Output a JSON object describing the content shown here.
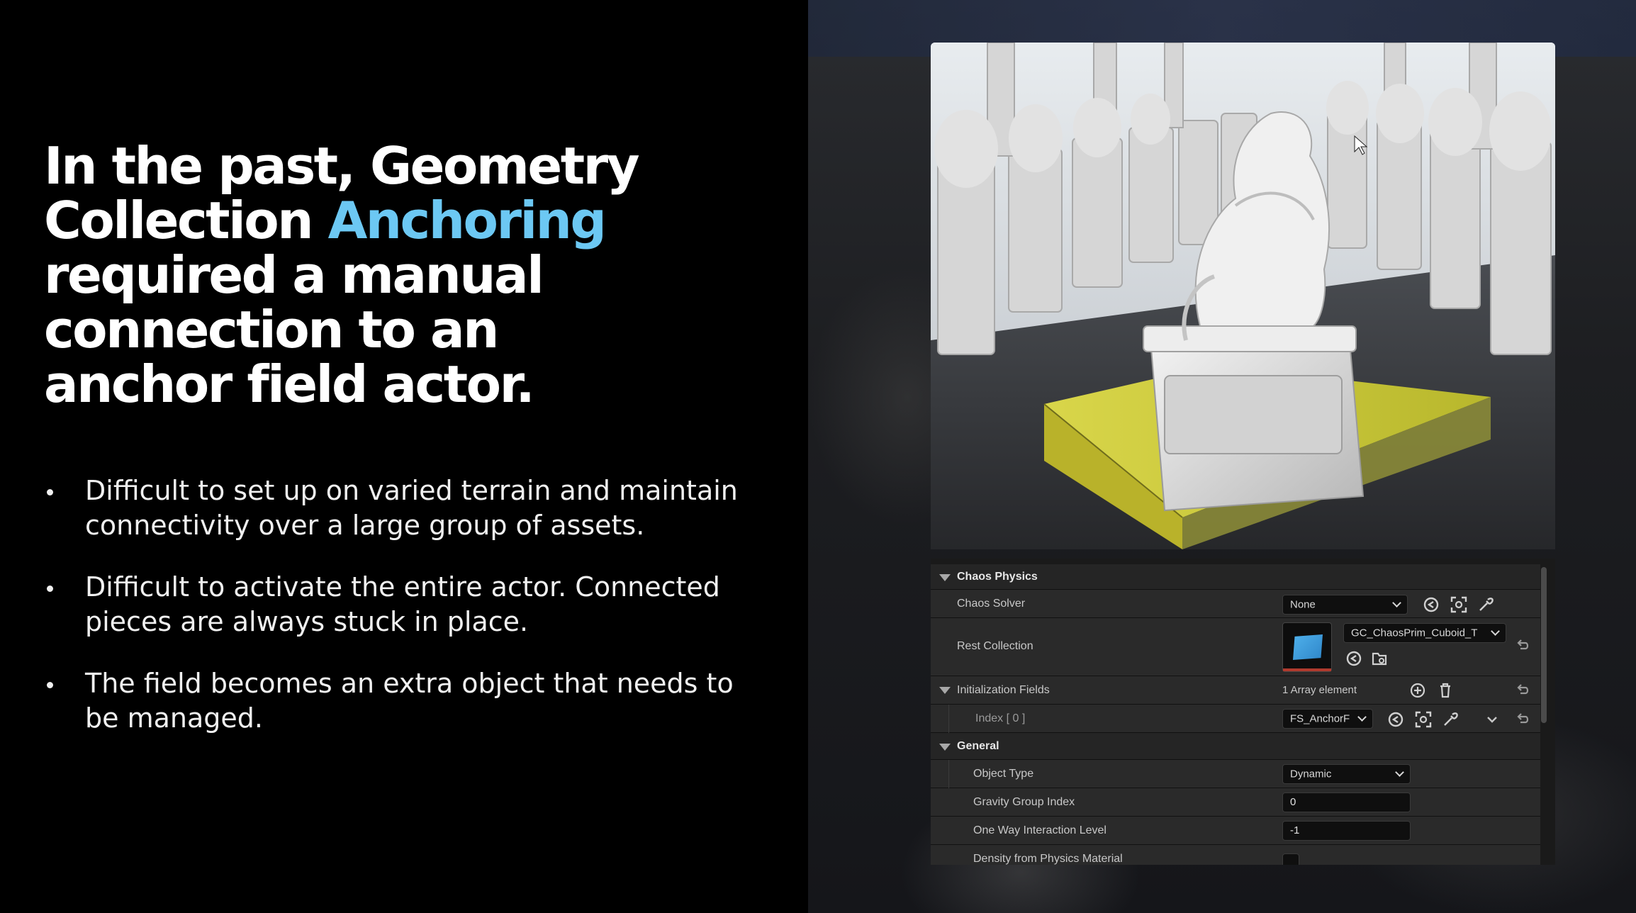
{
  "slide": {
    "headline_line1": "In the past, Geometry",
    "headline_line2_prefix": "Collection ",
    "headline_accent": "Anchoring",
    "headline_line3": "required a manual",
    "headline_line4": "connection to an",
    "headline_line5": "anchor field actor.",
    "bullets": [
      "Difficult to set up on varied terrain and maintain connectivity over a large group of assets.",
      "Difficult to activate the entire actor. Connected pieces are always stuck in place.",
      "The field becomes an extra object that needs to be managed."
    ],
    "accent_color": "#6cc8f3"
  },
  "panel": {
    "chaos_physics": {
      "header": "Chaos Physics",
      "chaos_solver_label": "Chaos Solver",
      "chaos_solver_value": "None",
      "rest_collection_label": "Rest Collection",
      "rest_collection_value": "GC_ChaosPrim_Cuboid_T"
    },
    "initialization_fields": {
      "label": "Initialization Fields",
      "count": "1 Array element",
      "index_label": "Index [ 0 ]",
      "index_value": "FS_AnchorF"
    },
    "general": {
      "header": "General",
      "object_type_label": "Object Type",
      "object_type_value": "Dynamic",
      "gravity_group_label": "Gravity Group Index",
      "gravity_group_value": "0",
      "one_way_label": "One Way Interaction Level",
      "one_way_value": "-1",
      "density_label": "Density from Physics Material"
    }
  },
  "icons": [
    "browse-icon",
    "focus-icon",
    "eyedropper-icon",
    "reset-icon",
    "add-icon",
    "trash-icon",
    "folder-icon",
    "chevron-down-icon"
  ]
}
